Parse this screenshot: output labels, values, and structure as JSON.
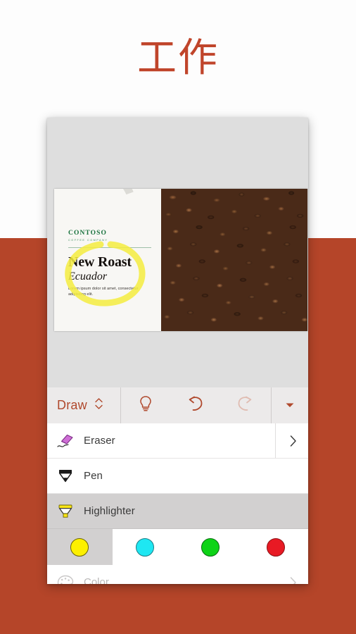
{
  "page": {
    "title": "工作",
    "title_color": "#c0452b",
    "background_top_color": "#fdfdfd",
    "background_bottom_color": "#b54529"
  },
  "slide": {
    "brand_name": "CONTOSO",
    "brand_subtitle": "COFFEE COMPANY",
    "brand_color": "#17713c",
    "title": "New Roast",
    "subtitle": "Ecuador",
    "body": "Lorem ipsum dolor sit amet, consectetur adipiscing elit.",
    "photo_alt": "coffee-beans-photo",
    "ink_annotation": "yellow-highlighter-ellipse",
    "ink_color": "#f2ea3a"
  },
  "ribbon": {
    "tab_label": "Draw",
    "tab_color": "#b0492d",
    "expand_icon": "chevron-up-down-icon",
    "tell_me_icon": "lightbulb-icon",
    "undo_icon": "undo-icon",
    "redo_icon": "redo-icon",
    "overflow_icon": "caret-down-icon",
    "undo_enabled": true,
    "redo_enabled": false
  },
  "tools": [
    {
      "label": "Eraser",
      "icon": "eraser-icon",
      "selected": false,
      "has_chevron": true
    },
    {
      "label": "Pen",
      "icon": "pen-icon",
      "selected": false,
      "has_chevron": false
    },
    {
      "label": "Highlighter",
      "icon": "highlighter-icon",
      "selected": true,
      "has_chevron": false
    }
  ],
  "swatches": [
    {
      "name": "yellow",
      "color": "#fdf000",
      "border": "#6b6400",
      "selected": true
    },
    {
      "name": "cyan",
      "color": "#1ee7f2",
      "border": "#1b7c85",
      "selected": false
    },
    {
      "name": "green",
      "color": "#0ed317",
      "border": "#0a6b10",
      "selected": false
    },
    {
      "name": "red",
      "color": "#e81a24",
      "border": "#8c1014",
      "selected": false
    }
  ],
  "color_row": {
    "label": "Color",
    "icon": "palette-icon",
    "chevron": "chevron-right-icon",
    "enabled": false
  }
}
